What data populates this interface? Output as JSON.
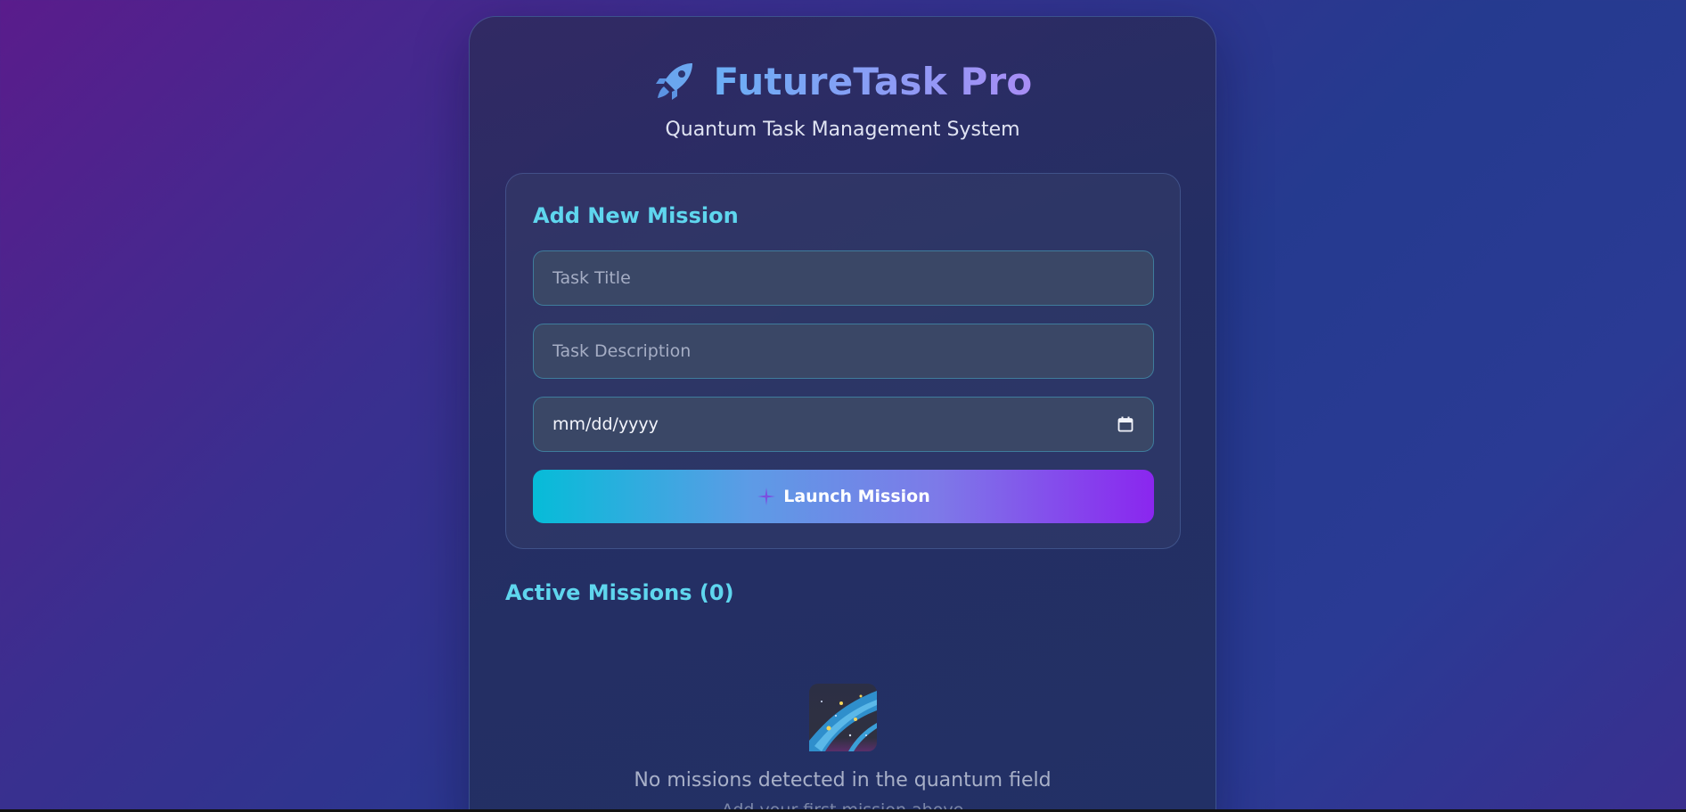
{
  "app": {
    "title": "FutureTask Pro",
    "subtitle": "Quantum Task Management System",
    "icon": "rocket-icon"
  },
  "form": {
    "heading": "Add New Mission",
    "title_placeholder": "Task Title",
    "title_value": "",
    "description_placeholder": "Task Description",
    "description_value": "",
    "date_value": "mm/dd/yyyy",
    "date_icon": "calendar-icon",
    "submit_label": "Launch Mission",
    "submit_icon": "sparkle-icon"
  },
  "missions": {
    "heading": "Active Missions (0)",
    "count": 0,
    "empty_icon": "milky-way-icon",
    "empty_message": "No missions detected in the quantum field",
    "empty_hint": "Add your first mission above"
  },
  "colors": {
    "accent_cyan": "#5fd6ee",
    "button_start": "#06bcd8",
    "button_end": "#8a26ef",
    "title_start": "#6aaef5",
    "title_end": "#a88df5"
  }
}
